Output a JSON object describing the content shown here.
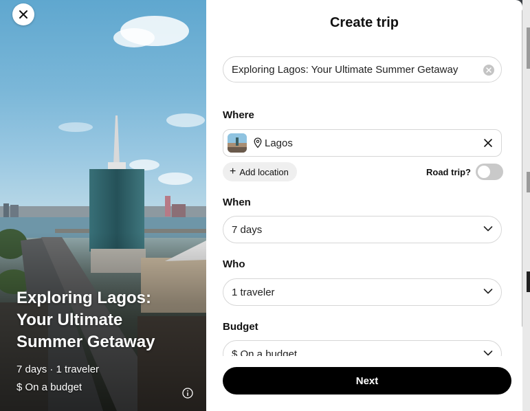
{
  "hero": {
    "title": "Exploring Lagos: Your Ultimate Summer Getaway",
    "meta": "7 days · 1 traveler",
    "budget": "$ On a budget"
  },
  "form": {
    "title": "Create trip",
    "trip_name": "Exploring Lagos: Your Ultimate Summer Getaway",
    "where_label": "Where",
    "location": "Lagos",
    "add_location_label": "Add location",
    "road_trip_label": "Road trip?",
    "road_trip_enabled": false,
    "when_label": "When",
    "when_value": "7 days",
    "who_label": "Who",
    "who_value": "1 traveler",
    "budget_label": "Budget",
    "budget_value": "$ On a budget",
    "next_label": "Next"
  },
  "icons": {
    "close": "close-icon",
    "clear": "clear-icon",
    "pin": "map-pin-icon",
    "remove": "remove-location-icon",
    "add": "plus-icon",
    "chevron": "chevron-down-icon",
    "info": "info-icon"
  },
  "colors": {
    "primary_button": "#000000",
    "toggle_off": "#c9c9c9",
    "border": "#d6d6d6"
  }
}
